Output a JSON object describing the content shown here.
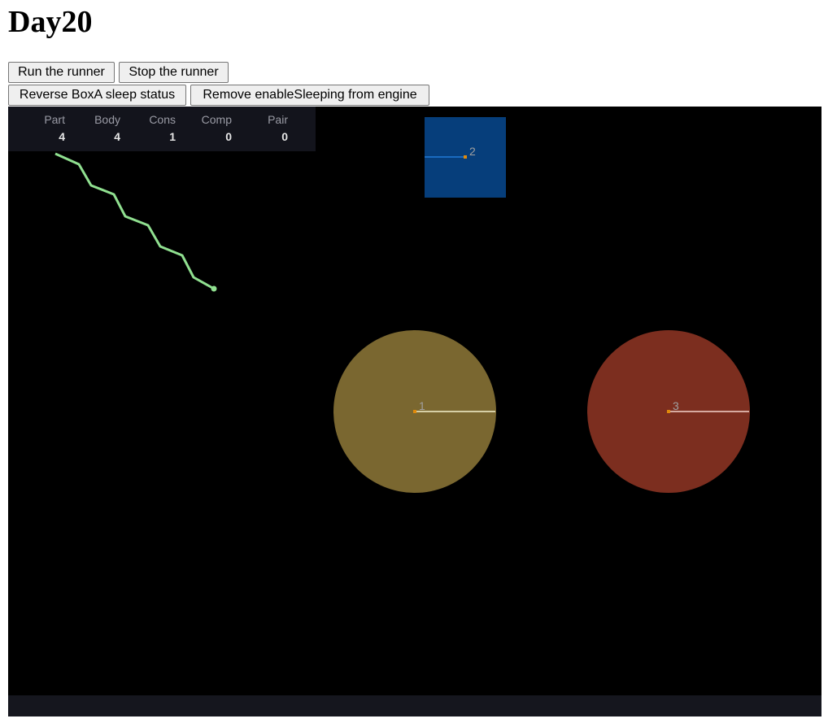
{
  "page": {
    "title": "Day20"
  },
  "buttons": {
    "run": "Run the runner",
    "stop": "Stop the runner",
    "reverse": "Reverse BoxA sleep status",
    "remove": "Remove enableSleeping from engine"
  },
  "stats": [
    {
      "label": "Part",
      "value": "4"
    },
    {
      "label": "Body",
      "value": "4"
    },
    {
      "label": "Cons",
      "value": "1"
    },
    {
      "label": "Comp",
      "value": "0"
    },
    {
      "label": "Pair",
      "value": "0"
    }
  ],
  "bodies": [
    {
      "id": "1",
      "shape": "circle",
      "fill": "#7a6730"
    },
    {
      "id": "2",
      "shape": "box",
      "fill": "#063e7b"
    },
    {
      "id": "3",
      "shape": "circle",
      "fill": "#7c2e1f"
    }
  ],
  "colors": {
    "canvas_bg": "#000000",
    "constraint": "#90e090",
    "center_marker": "#e08a0b",
    "id_label": "#a0a0a0"
  }
}
